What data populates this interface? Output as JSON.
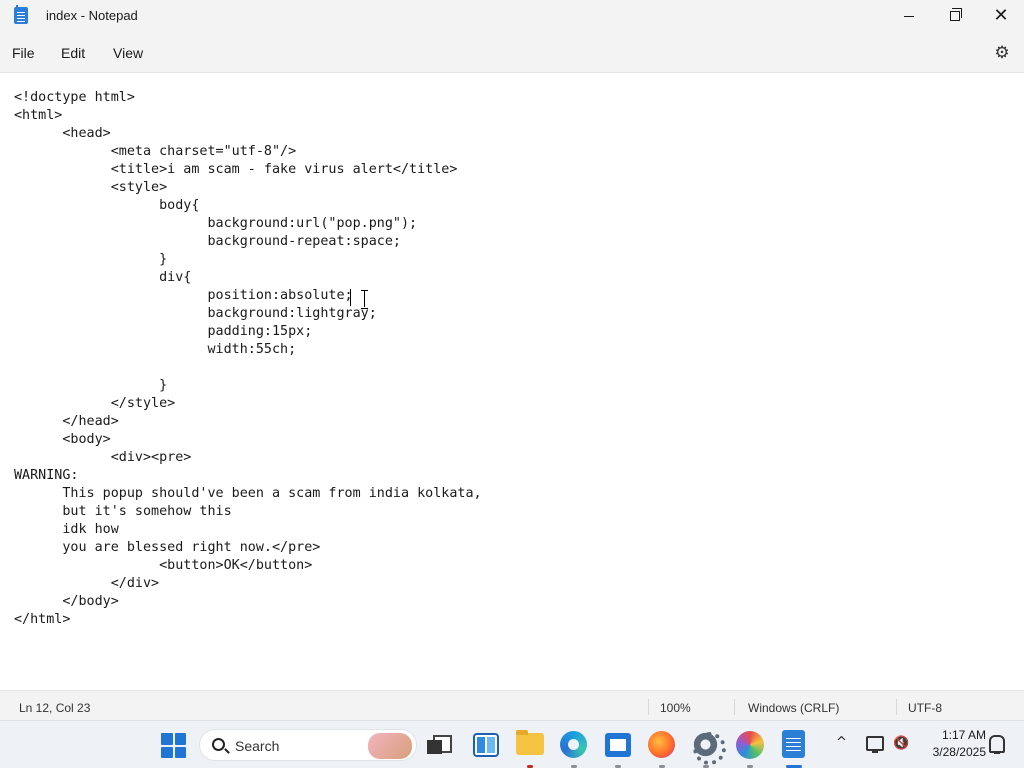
{
  "window": {
    "title": "index - Notepad",
    "controls": [
      "minimize",
      "maximize",
      "close"
    ]
  },
  "menu": {
    "file": "File",
    "edit": "Edit",
    "view": "View",
    "settings_icon": "gear-icon"
  },
  "editor": {
    "lines": [
      "<!doctype html>",
      "<html>",
      "\t<head>",
      "\t\t<meta charset=\"utf-8\"/>",
      "\t\t<title>i am scam - fake virus alert</title>",
      "\t\t<style>",
      "\t\t\tbody{",
      "\t\t\t\tbackground:url(\"pop.png\");",
      "\t\t\t\tbackground-repeat:space;",
      "\t\t\t}",
      "\t\t\tdiv{",
      "\t\t\t\tposition:absolute;",
      "\t\t\t\tbackground:lightgray;",
      "\t\t\t\tpadding:15px;",
      "\t\t\t\twidth:55ch;",
      "",
      "\t\t\t}",
      "\t\t</style>",
      "\t</head>",
      "\t<body>",
      "\t\t<div><pre>",
      "WARNING:",
      "\tThis popup should've been a scam from india kolkata,",
      "\tbut it's somehow this",
      "\tidk how",
      "\tyou are blessed right now.</pre>",
      "\t\t\t<button>OK</button>",
      "\t\t</div>",
      "\t</body>",
      "</html>"
    ]
  },
  "status": {
    "position": "Ln 12, Col 23",
    "zoom": "100%",
    "line_ending": "Windows (CRLF)",
    "encoding": "UTF-8"
  },
  "taskbar": {
    "search_label": "Search",
    "apps": [
      "start",
      "task-view",
      "widgets",
      "file-explorer",
      "edge",
      "store",
      "firefox",
      "settings",
      "paint",
      "notepad"
    ],
    "clock_time": "1:17 AM",
    "clock_date": "3/28/2025"
  },
  "colors": {
    "accent": "#1f74d4",
    "window_bg": "#f3f3f3",
    "editor_bg": "#ffffff"
  }
}
